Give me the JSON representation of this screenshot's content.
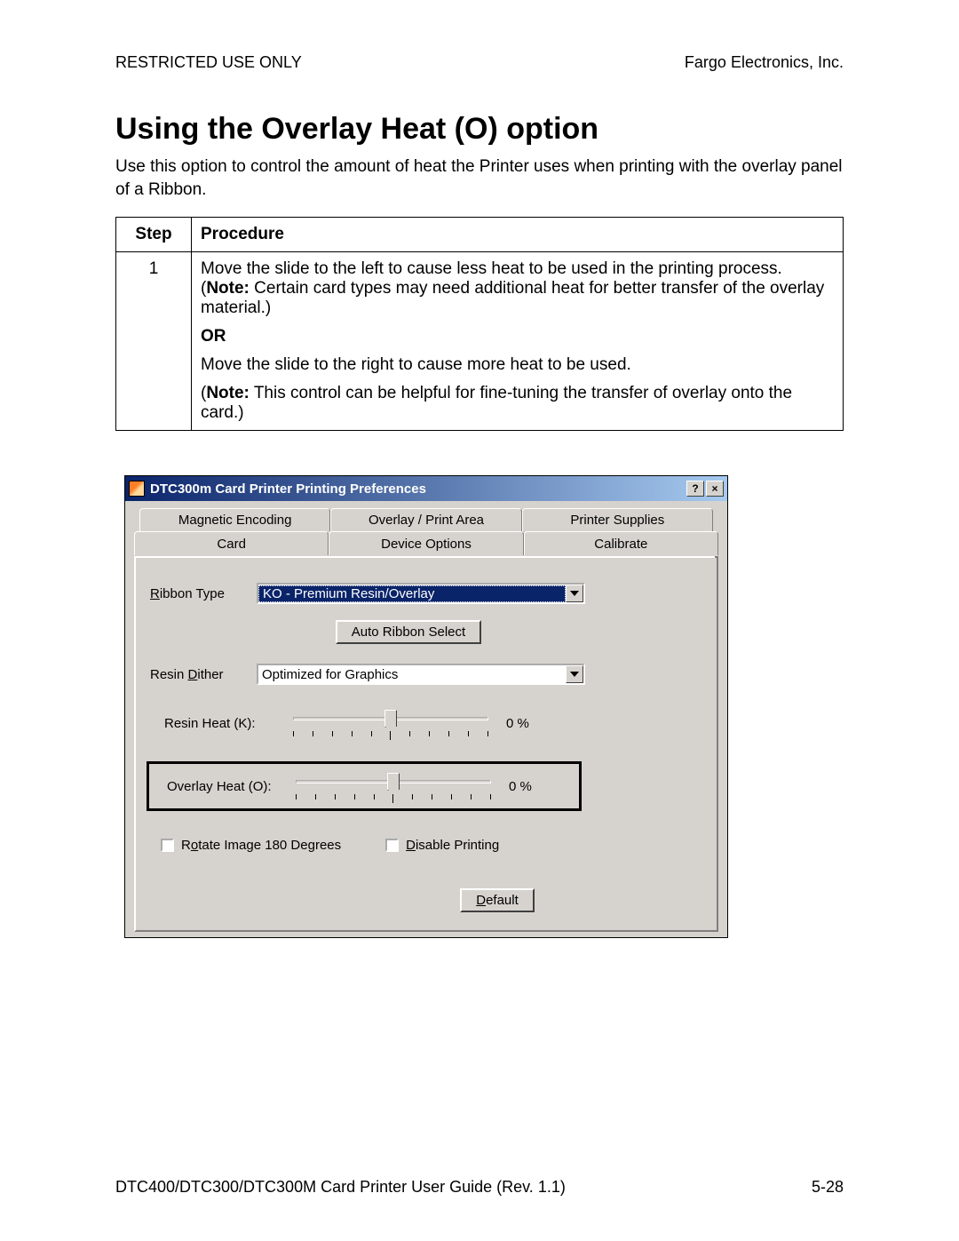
{
  "header": {
    "left": "RESTRICTED USE ONLY",
    "right": "Fargo Electronics, Inc."
  },
  "title": "Using the Overlay Heat (O) option",
  "intro": "Use this option to control the amount of heat the Printer uses when printing with the overlay panel of a Ribbon.",
  "table": {
    "head_step": "Step",
    "head_proc": "Procedure",
    "step": "1",
    "p1a": "Move the slide to the left to cause less heat to be used in the printing process. (",
    "p1note": "Note:",
    "p1b": "  Certain card types may need additional heat for better transfer of the overlay material.)",
    "or": "OR",
    "p2": "Move the slide to the right to cause more heat to be used.",
    "p3a": "(",
    "p3note": "Note:",
    "p3b": "  This control can be helpful for fine-tuning the transfer of overlay onto the card.)"
  },
  "dlg": {
    "title": "DTC300m Card Printer Printing Preferences",
    "help": "?",
    "close": "×",
    "tabs_row1": [
      "Magnetic Encoding",
      "Overlay / Print Area",
      "Printer Supplies"
    ],
    "tabs_row2": [
      "Card",
      "Device Options",
      "Calibrate"
    ],
    "ribbon_label_pre": "R",
    "ribbon_label_post": "ibbon Type",
    "ribbon_value": "KO - Premium Resin/Overlay",
    "auto_ribbon": "Auto Ribbon Select",
    "dither_label_a": "Resin ",
    "dither_label_u": "D",
    "dither_label_b": "ither",
    "dither_value": "Optimized for Graphics",
    "resin_heat_label": "Resin Heat  (K):",
    "resin_heat_value": "0 %",
    "overlay_heat_label": "Overlay Heat  (O):",
    "overlay_heat_value": "0 %",
    "rotate_a": "R",
    "rotate_u": "o",
    "rotate_b": "tate Image 180 Degrees",
    "disable_u": "D",
    "disable_b": "isable Printing",
    "default_u": "D",
    "default_b": "efault"
  },
  "footer": {
    "left": "DTC400/DTC300/DTC300M Card Printer User Guide (Rev. 1.1)",
    "right": "5-28"
  }
}
